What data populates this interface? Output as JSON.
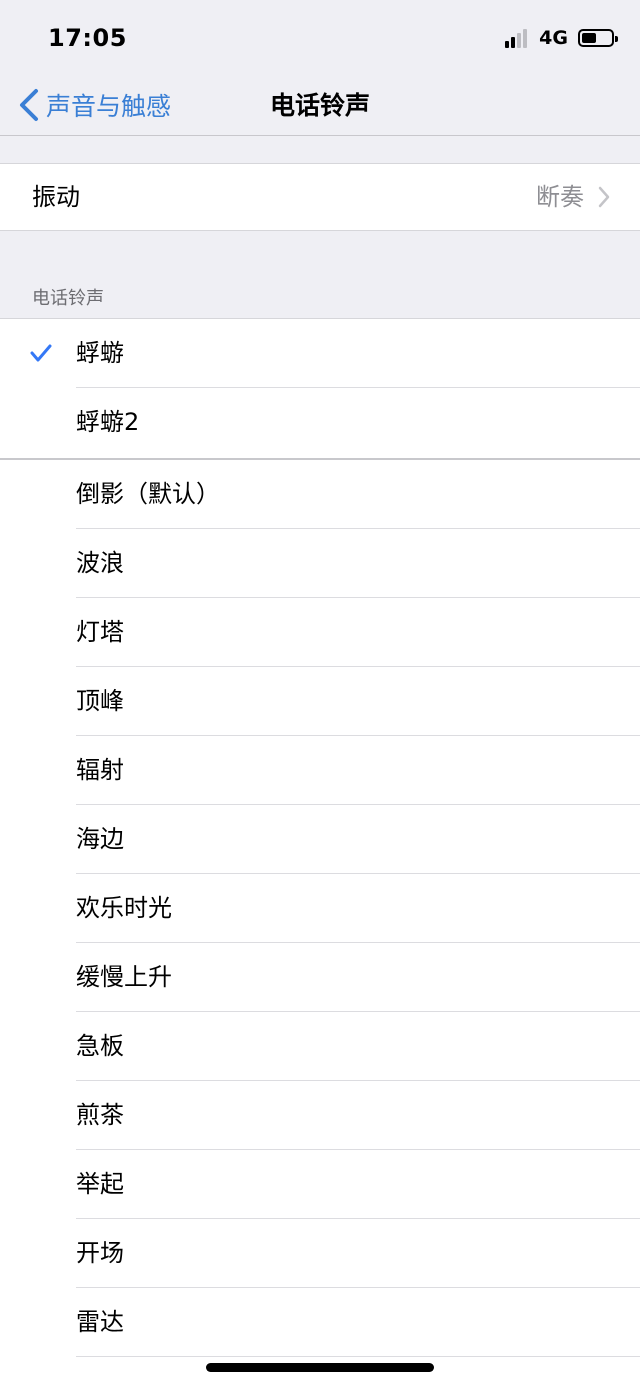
{
  "status": {
    "time": "17:05",
    "network": "4G"
  },
  "nav": {
    "back_label": "声音与触感",
    "title": "电话铃声"
  },
  "vibration": {
    "label": "振动",
    "value": "断奏"
  },
  "section_header": "电话铃声",
  "custom_tones": [
    {
      "label": "蜉蝣",
      "selected": true
    },
    {
      "label": "蜉蝣2",
      "selected": false
    }
  ],
  "tones": [
    "倒影（默认）",
    "波浪",
    "灯塔",
    "顶峰",
    "辐射",
    "海边",
    "欢乐时光",
    "缓慢上升",
    "急板",
    "煎茶",
    "举起",
    "开场",
    "雷达"
  ],
  "colors": {
    "accent": "#3478f6",
    "background": "#efeff4",
    "secondary_text": "#8e8e93"
  }
}
